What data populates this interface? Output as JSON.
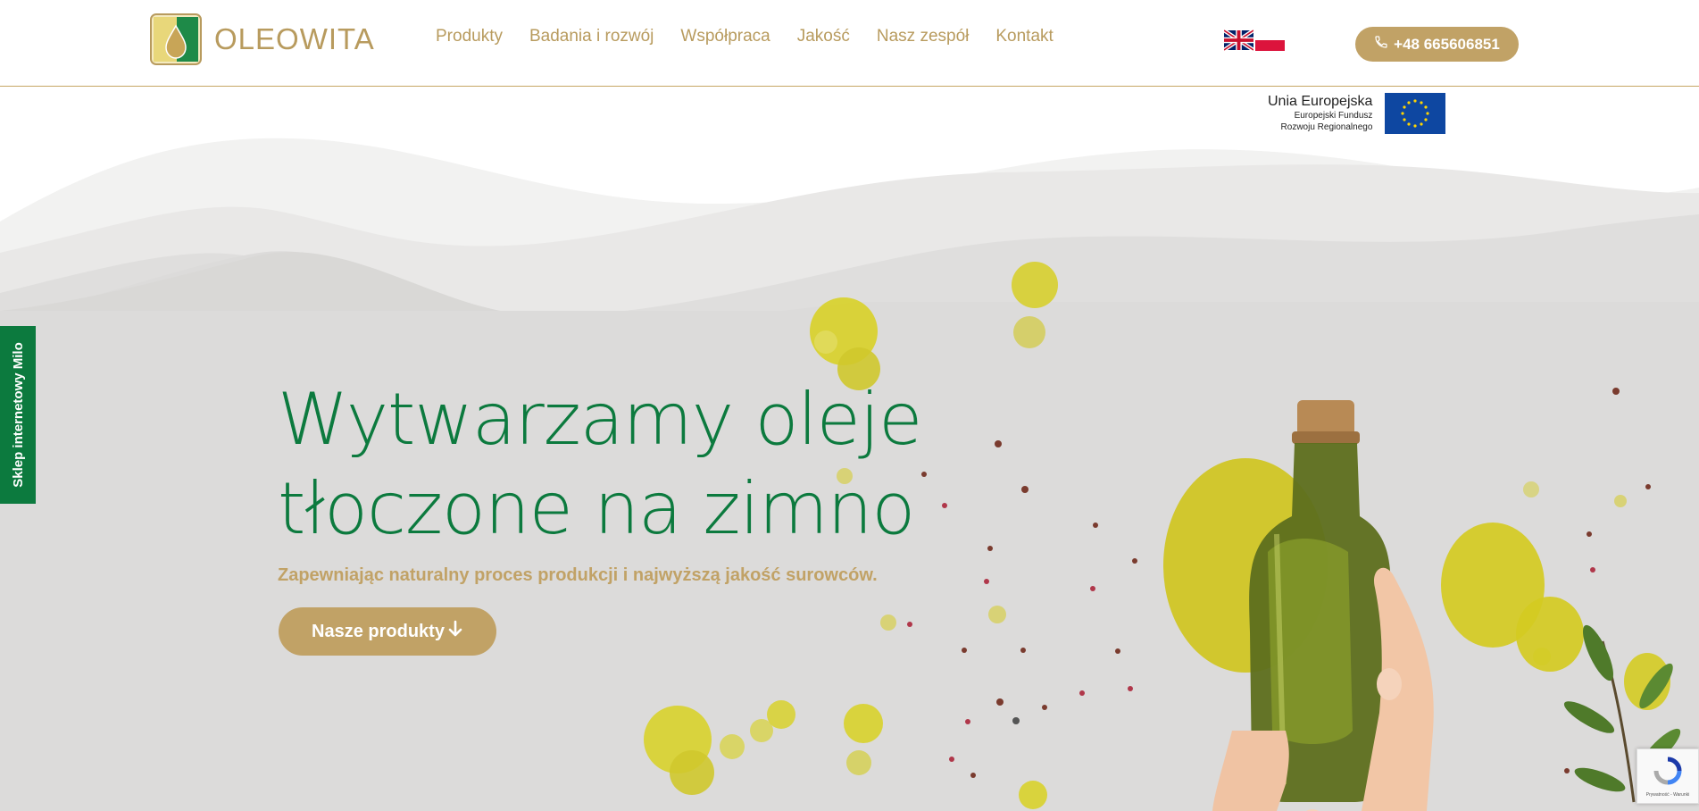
{
  "header": {
    "logo_text": "OLEOWITA",
    "nav": [
      "Produkty",
      "Badania i rozwój",
      "Współpraca",
      "Jakość",
      "Nasz zespół",
      "Kontakt"
    ],
    "languages": [
      "english-flag",
      "polish-flag"
    ],
    "phone": "+48 665606851"
  },
  "eu_badge": {
    "title": "Unia Europejska",
    "line1": "Europejski Fundusz",
    "line2": "Rozwoju Regionalnego"
  },
  "hero": {
    "title_line1": "Wytwarzamy oleje",
    "title_line2": "tłoczone na zimno",
    "subtitle": "Zapewniając naturalny proces produkcji i najwyższą jakość surowców.",
    "cta": "Nasze produkty"
  },
  "side_tab": "Sklep internetowy Milo",
  "recaptcha_text": "Prywatność - Warunki",
  "colors": {
    "accent_gold": "#c1a266",
    "brand_green": "#0c7a3e",
    "hero_background": "#dcdbda"
  }
}
